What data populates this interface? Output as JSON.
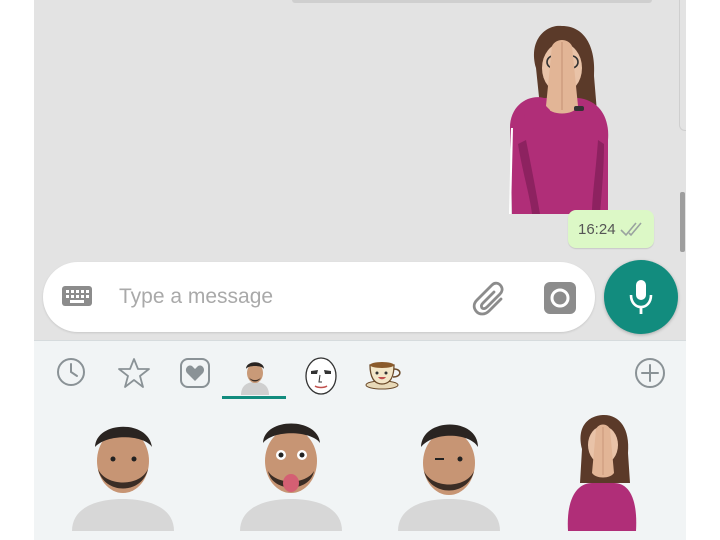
{
  "chat": {
    "message": {
      "type": "sticker",
      "time": "16:24",
      "status_icon": "double-check-icon"
    }
  },
  "input_bar": {
    "placeholder": "Type a message",
    "keyboard_icon": "keyboard-icon",
    "attach_icon": "paperclip-icon",
    "camera_icon": "camera-icon",
    "mic_icon": "microphone-icon"
  },
  "sticker_tabs": [
    {
      "name": "recent",
      "icon": "clock-icon"
    },
    {
      "name": "favorites",
      "icon": "star-icon"
    },
    {
      "name": "love",
      "icon": "heart-icon"
    },
    {
      "name": "man-pack",
      "icon": "man-sticker-thumb",
      "selected": true
    },
    {
      "name": "face-pack",
      "icon": "face-sticker-thumb"
    },
    {
      "name": "coffee-pack",
      "icon": "coffee-cup-sticker-thumb"
    },
    {
      "name": "add",
      "icon": "plus-icon"
    }
  ],
  "colors": {
    "accent": "#128c7e",
    "chat_background": "#e3e3e3",
    "outgoing_bubble": "#dcf8c6",
    "panel_background": "#f1f4f5"
  }
}
